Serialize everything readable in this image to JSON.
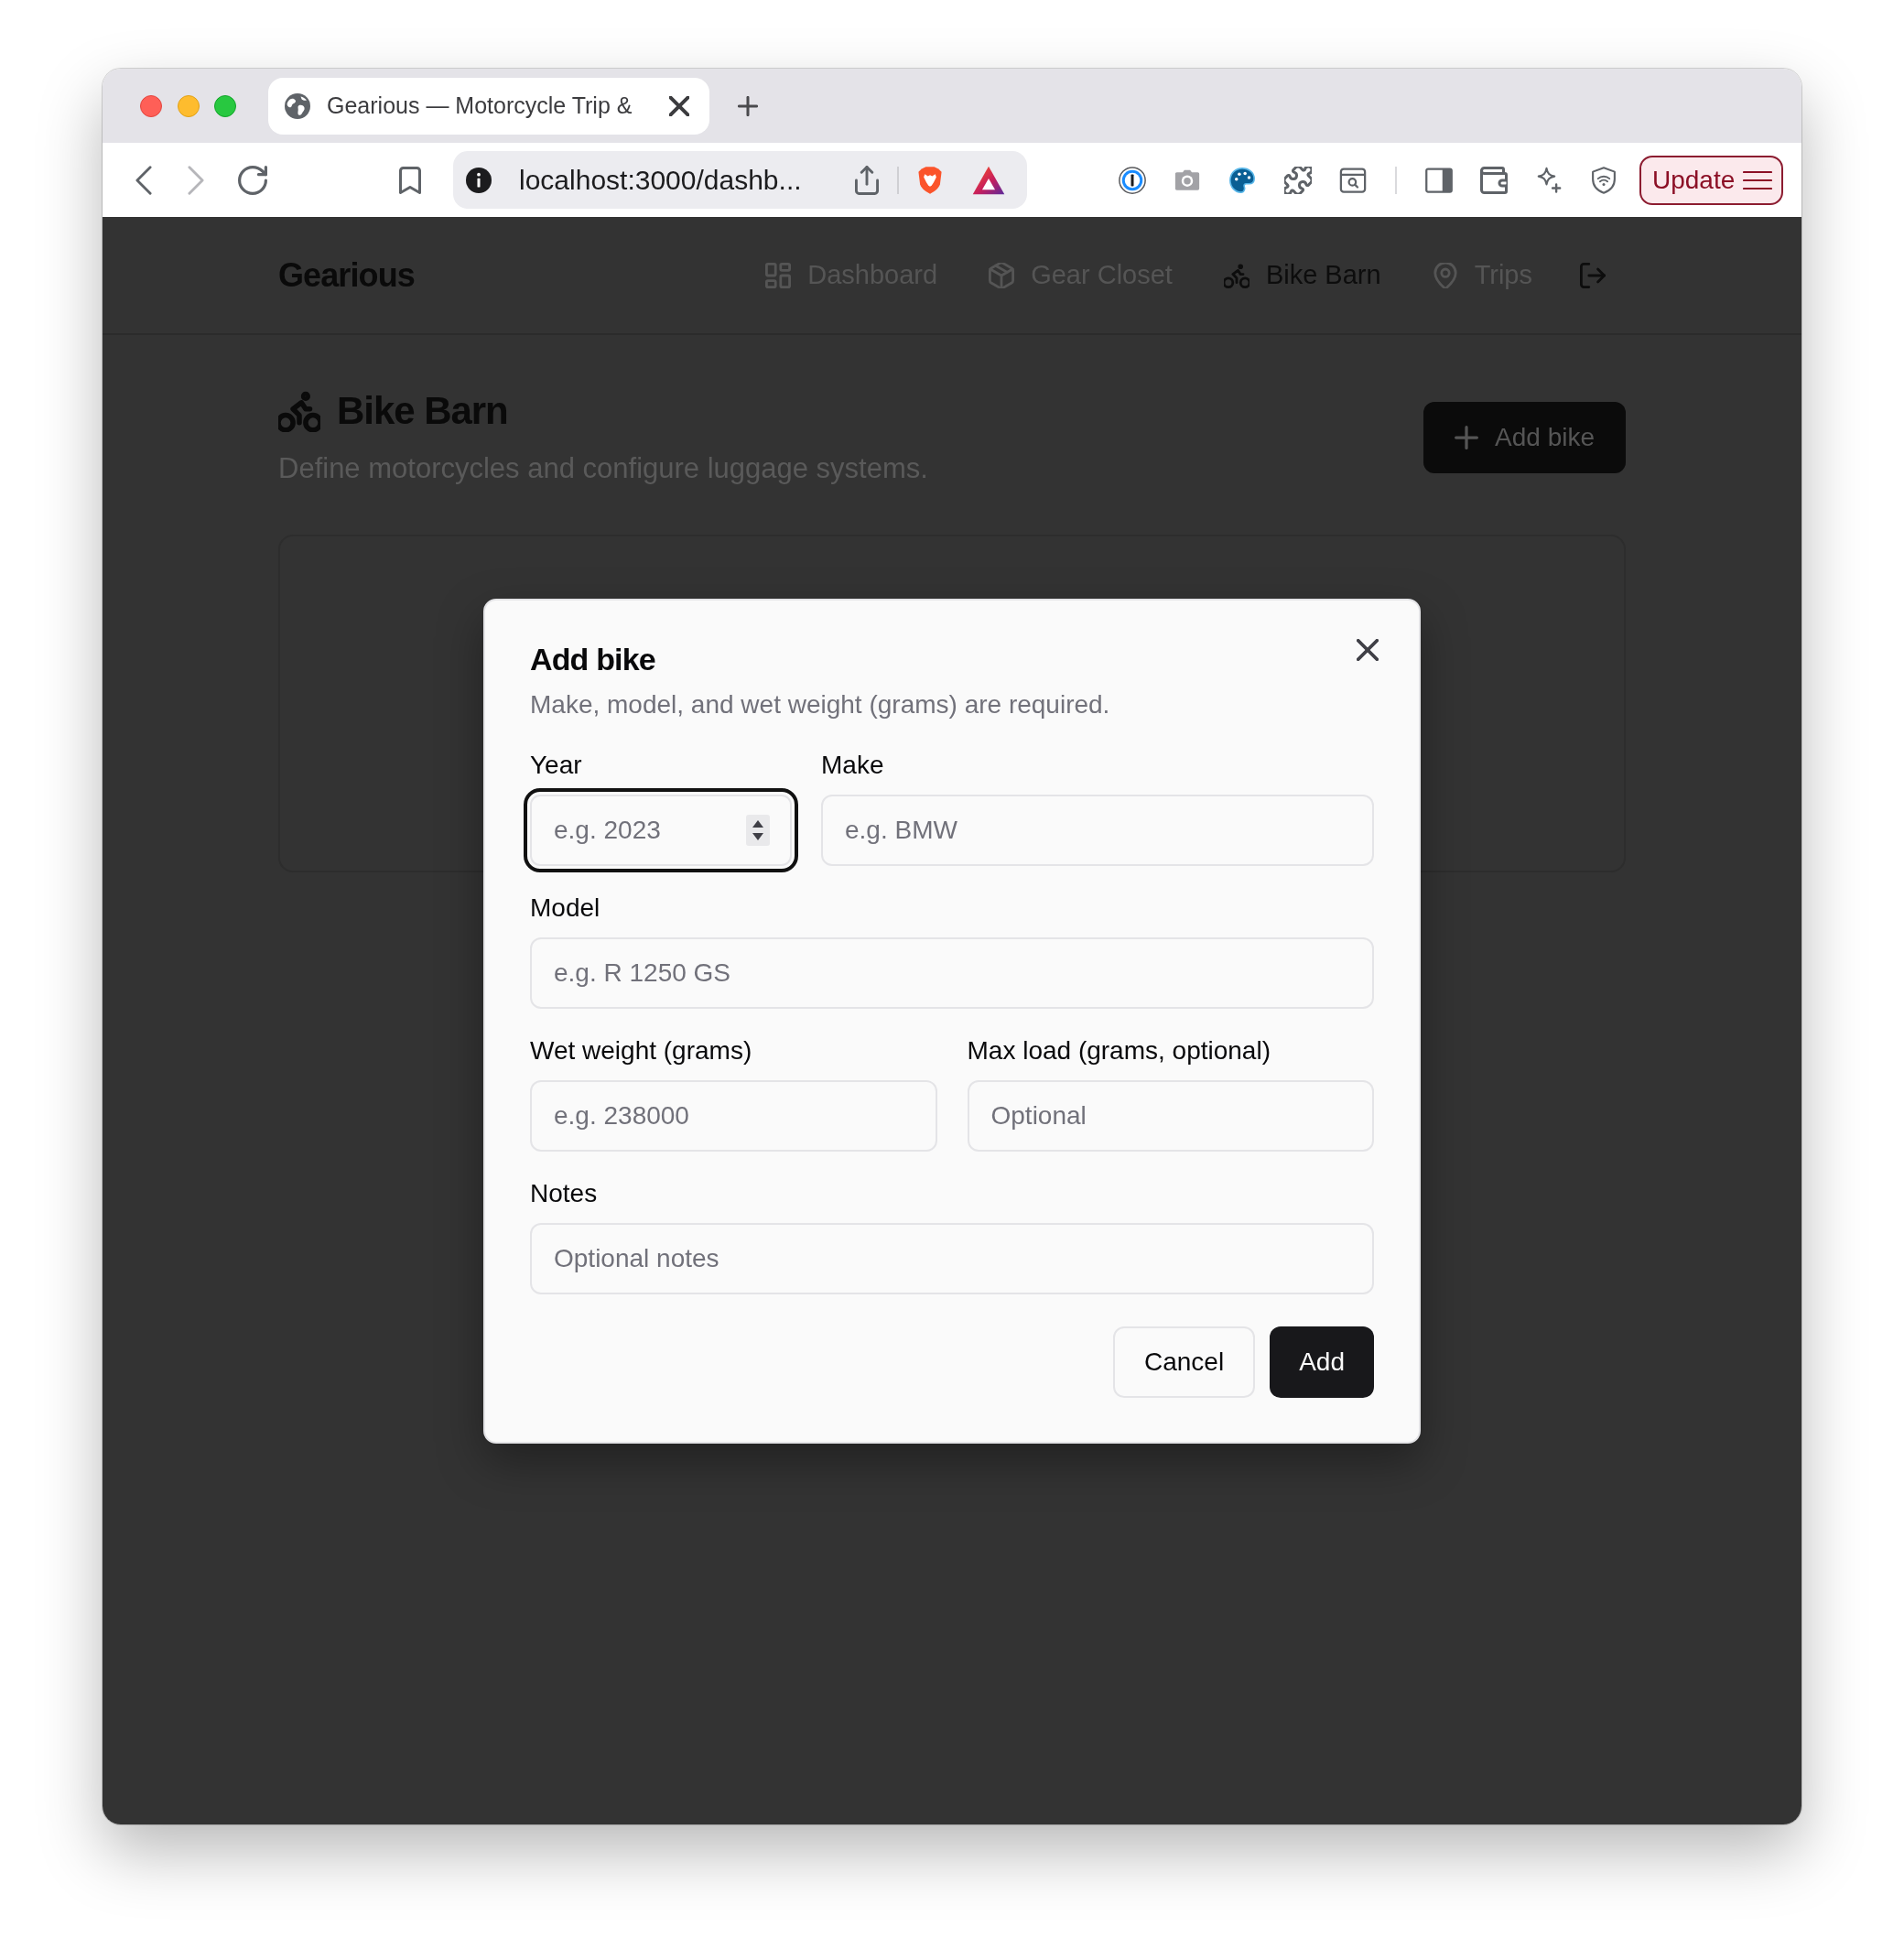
{
  "browser": {
    "back": {
      "disabled": false
    },
    "forward": {
      "disabled": true
    },
    "tab": {
      "title": "Gearious — Motorcycle Trip &"
    },
    "address_bar": {
      "url": "localhost:3000/dashb..."
    },
    "update_button": {
      "label": "Update"
    }
  },
  "header": {
    "brand": "Gearious",
    "nav": [
      {
        "label": "Dashboard",
        "selected": false
      },
      {
        "label": "Gear Closet",
        "selected": false
      },
      {
        "label": "Bike Barn",
        "selected": true
      },
      {
        "label": "Trips",
        "selected": false
      }
    ]
  },
  "page": {
    "title": "Bike Barn",
    "description": "Define motorcycles and configure luggage systems.",
    "add_button": {
      "label": "Add bike"
    }
  },
  "dialog": {
    "title": "Add bike",
    "description": "Make, model, and wet weight (grams) are required.",
    "rows": [
      [
        {
          "label": "Year",
          "placeholder": "e.g. 2023",
          "kind": "number",
          "focused": true
        },
        {
          "label": "Make",
          "placeholder": "e.g. BMW",
          "kind": "text",
          "focused": false
        }
      ],
      [
        {
          "label": "Model",
          "placeholder": "e.g. R 1250 GS",
          "kind": "text",
          "focused": false
        }
      ],
      [
        {
          "label": "Wet weight (grams)",
          "placeholder": "e.g. 238000",
          "kind": "text",
          "focused": false
        },
        {
          "label": "Max load (grams, optional)",
          "placeholder": "Optional",
          "kind": "text",
          "focused": false
        }
      ],
      [
        {
          "label": "Notes",
          "placeholder": "Optional notes",
          "kind": "text",
          "focused": false
        }
      ]
    ],
    "buttons": [
      {
        "label": "Cancel",
        "kind": "secondary"
      },
      {
        "label": "Add",
        "kind": "primary"
      }
    ]
  }
}
